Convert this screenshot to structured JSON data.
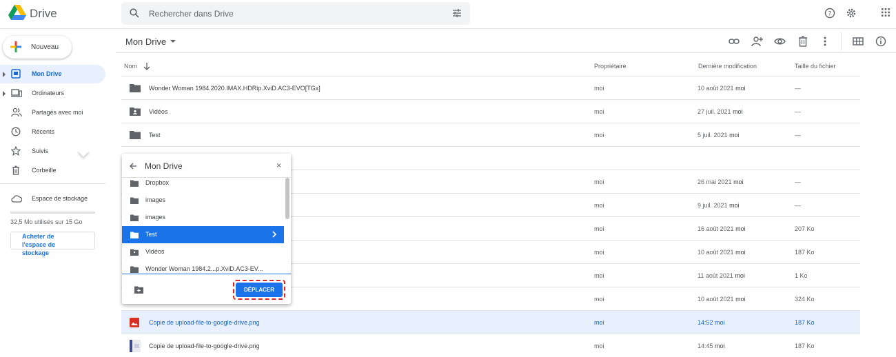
{
  "app": {
    "name": "Drive"
  },
  "search": {
    "placeholder": "Rechercher dans Drive"
  },
  "sidebar": {
    "new_label": "Nouveau",
    "items": [
      {
        "label": "Mon Drive",
        "icon": "my-drive-icon",
        "active": true,
        "expandable": true
      },
      {
        "label": "Ordinateurs",
        "icon": "computers-icon",
        "active": false,
        "expandable": true
      },
      {
        "label": "Partagés avec moi",
        "icon": "shared-icon",
        "active": false,
        "expandable": false
      },
      {
        "label": "Récents",
        "icon": "clock-icon",
        "active": false,
        "expandable": false
      },
      {
        "label": "Suivis",
        "icon": "star-icon",
        "active": false,
        "expandable": false
      },
      {
        "label": "Corbeille",
        "icon": "trash-icon",
        "active": false,
        "expandable": false
      }
    ],
    "storage_label": "Espace de stockage",
    "storage_usage": "32,5 Mo utilisés sur 15 Go",
    "buy_storage": "Acheter de l'espace de stockage"
  },
  "toolbar": {
    "breadcrumb": "Mon Drive"
  },
  "columns": {
    "name": "Nom",
    "owner": "Propriétaire",
    "modified": "Dernière modification",
    "size": "Taille du fichier"
  },
  "files": [
    {
      "name": "Wonder Woman 1984.2020.IMAX.HDRip.XviD.AC3-EVO[TGx]",
      "icon": "folder-icon",
      "owner": "moi",
      "date": "10 août 2021",
      "by": "moi",
      "size": "—",
      "selected": false
    },
    {
      "name": "Vidéos",
      "icon": "shared-folder-icon",
      "owner": "moi",
      "date": "27 juil. 2021",
      "by": "moi",
      "size": "—",
      "selected": false
    },
    {
      "name": "Test",
      "icon": "folder-icon",
      "owner": "moi",
      "date": "5 juil. 2021",
      "by": "moi",
      "size": "—",
      "selected": false
    },
    {
      "name": "",
      "icon": "",
      "owner": "",
      "date": "",
      "by": "",
      "size": "",
      "selected": false
    },
    {
      "name": "",
      "icon": "",
      "owner": "moi",
      "date": "26 mai 2021",
      "by": "moi",
      "size": "—",
      "selected": false
    },
    {
      "name": "",
      "icon": "",
      "owner": "moi",
      "date": "9 juil. 2021",
      "by": "moi",
      "size": "—",
      "selected": false
    },
    {
      "name": "",
      "icon": "",
      "owner": "moi",
      "date": "16 août 2021",
      "by": "moi",
      "size": "207 Ko",
      "selected": false
    },
    {
      "name": "",
      "icon": "",
      "owner": "moi",
      "date": "10 août 2021",
      "by": "moi",
      "size": "187 Ko",
      "selected": false
    },
    {
      "name": "",
      "icon": "",
      "owner": "moi",
      "date": "11 août 2021",
      "by": "moi",
      "size": "1 Ko",
      "selected": false
    },
    {
      "name": "",
      "icon": "",
      "owner": "moi",
      "date": "10 août 2021",
      "by": "moi",
      "size": "324 Ko",
      "selected": false
    },
    {
      "name": "Copie de upload-file-to-google-drive.png",
      "icon": "image-file-icon",
      "owner": "moi",
      "date": "14:52",
      "by": "moi",
      "size": "187 Ko",
      "selected": true
    },
    {
      "name": "Copie de upload-file-to-google-drive.png",
      "icon": "image-thumb-icon",
      "owner": "moi",
      "date": "14:45",
      "by": "moi",
      "size": "187 Ko",
      "selected": false
    }
  ],
  "move_dialog": {
    "title": "Mon Drive",
    "close": "×",
    "folders": [
      {
        "label": "Dropbox",
        "icon": "folder-icon",
        "active": false
      },
      {
        "label": "images",
        "icon": "folder-icon",
        "active": false
      },
      {
        "label": "images",
        "icon": "folder-icon",
        "active": false
      },
      {
        "label": "Test",
        "icon": "folder-icon",
        "active": true
      },
      {
        "label": "Vidéos",
        "icon": "shared-folder-icon",
        "active": false
      },
      {
        "label": "Wonder Woman 1984.2...p.XviD.AC3-EV...",
        "icon": "folder-icon",
        "active": false
      }
    ],
    "move_button": "DÉPLACER"
  }
}
